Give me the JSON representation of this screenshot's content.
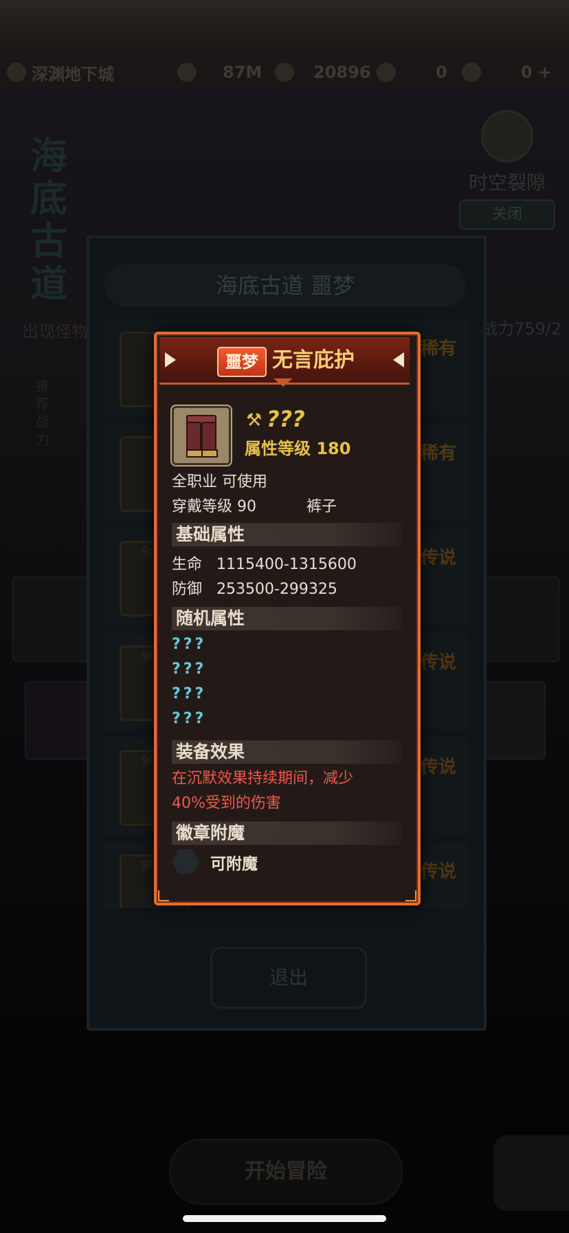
{
  "hud": {
    "location": "深渊地下城",
    "gold": "87M",
    "gems": "20896",
    "stat1": "0",
    "stat2": "0"
  },
  "side_title": [
    "海",
    "底",
    "古",
    "道"
  ],
  "rift": {
    "label": "时空裂隙",
    "button": "关闭"
  },
  "bg_labels": {
    "monsters": "出现怪物",
    "side_note": "推荐战力",
    "right_note": "战力759/2"
  },
  "map_modal": {
    "title": "海底古道 噩梦",
    "rows": [
      {
        "level": "",
        "rarity": "稀有",
        "rarity_type": "rare"
      },
      {
        "level": "",
        "rarity": "稀有",
        "rarity_type": "rare"
      },
      {
        "level": "90",
        "rarity": "传说",
        "rarity_type": "legend"
      },
      {
        "level": "90",
        "rarity": "传说",
        "rarity_type": "legend"
      },
      {
        "level": "90",
        "rarity": "传说",
        "rarity_type": "legend"
      },
      {
        "level": "90",
        "rarity": "传说",
        "rarity_type": "legend"
      }
    ],
    "exit_button": "退出"
  },
  "start_button": "开始冒险",
  "item": {
    "difficulty_badge": "噩梦",
    "name": "无言庇护",
    "unknown_name": "???",
    "attr_level": "属性等级 180",
    "class_req": "全职业 可使用",
    "wear_level_label": "穿戴等级",
    "wear_level": "90",
    "slot": "裤子",
    "base_header": "基础属性",
    "base_stats": [
      {
        "label": "生命",
        "value": "1115400-1315600"
      },
      {
        "label": "防御",
        "value": "253500-299325"
      }
    ],
    "random_header": "随机属性",
    "random_stats": [
      "???",
      "???",
      "???",
      "???"
    ],
    "effect_header": "装备效果",
    "effect_line1": "在沉默效果持续期间，减少",
    "effect_line2": "40%受到的伤害",
    "enchant_header": "徽章附魔",
    "enchant_status": "可附魔"
  },
  "colors": {
    "frame": "#e76b32",
    "title_gold": "#f6cf74",
    "effect_red": "#f2584a",
    "unknown_cyan": "#69c8d8"
  }
}
